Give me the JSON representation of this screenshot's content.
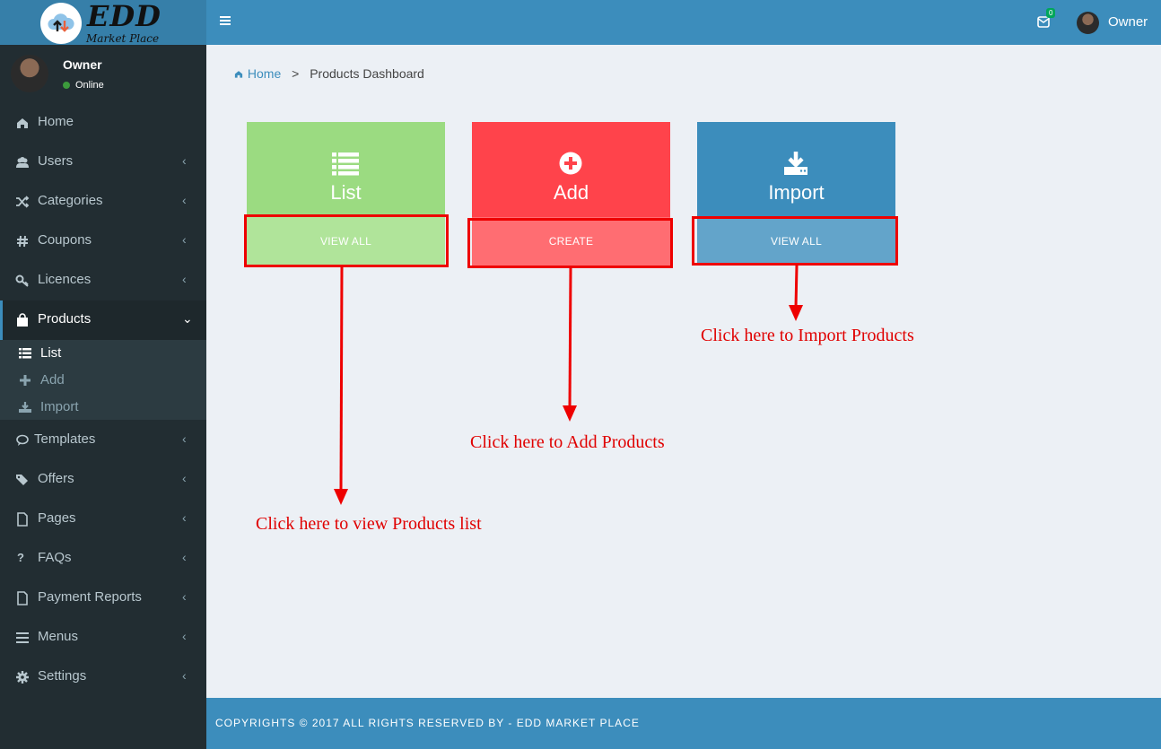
{
  "logo": {
    "brand": "EDD",
    "sub": "Market Place"
  },
  "user": {
    "name": "Owner",
    "status": "Online"
  },
  "header": {
    "mail_count": "0",
    "user_name": "Owner"
  },
  "sidebar": {
    "items": [
      {
        "label": "Home",
        "icon": "home-icon"
      },
      {
        "label": "Users",
        "icon": "users-icon"
      },
      {
        "label": "Categories",
        "icon": "shuffle-icon"
      },
      {
        "label": "Coupons",
        "icon": "hashtag-icon"
      },
      {
        "label": "Licences",
        "icon": "key-icon"
      },
      {
        "label": "Products",
        "icon": "shopping-bag-icon"
      },
      {
        "label": "Templates",
        "icon": "comment-icon"
      },
      {
        "label": "Offers",
        "icon": "tags-icon"
      },
      {
        "label": "Pages",
        "icon": "file-icon"
      },
      {
        "label": "FAQs",
        "icon": "question-icon"
      },
      {
        "label": "Payment Reports",
        "icon": "file-icon"
      },
      {
        "label": "Menus",
        "icon": "bars-icon"
      },
      {
        "label": "Settings",
        "icon": "gear-icon"
      }
    ],
    "products_sub": [
      {
        "label": "List",
        "icon": "list-icon"
      },
      {
        "label": "Add",
        "icon": "plus-icon"
      },
      {
        "label": "Import",
        "icon": "download-icon"
      }
    ]
  },
  "breadcrumb": {
    "home": "Home",
    "current": "Products Dashboard"
  },
  "tiles": [
    {
      "title": "List",
      "action": "VIEW ALL",
      "color": "#9bdb81",
      "action_color": "#b0e49a"
    },
    {
      "title": "Add",
      "action": "CREATE",
      "color": "#ff434b",
      "action_color": "#ff6d72"
    },
    {
      "title": "Import",
      "action": "VIEW ALL",
      "color": "#3c8dbc",
      "action_color": "#63a4ca"
    }
  ],
  "annotations": {
    "list": "Click here to view Products list",
    "add": "Click here to Add Products",
    "import": "Click here to Import Products"
  },
  "footer": {
    "text": "COPYRIGHTS © 2017 ALL RIGHTS RESERVED BY - EDD MARKET PLACE"
  }
}
